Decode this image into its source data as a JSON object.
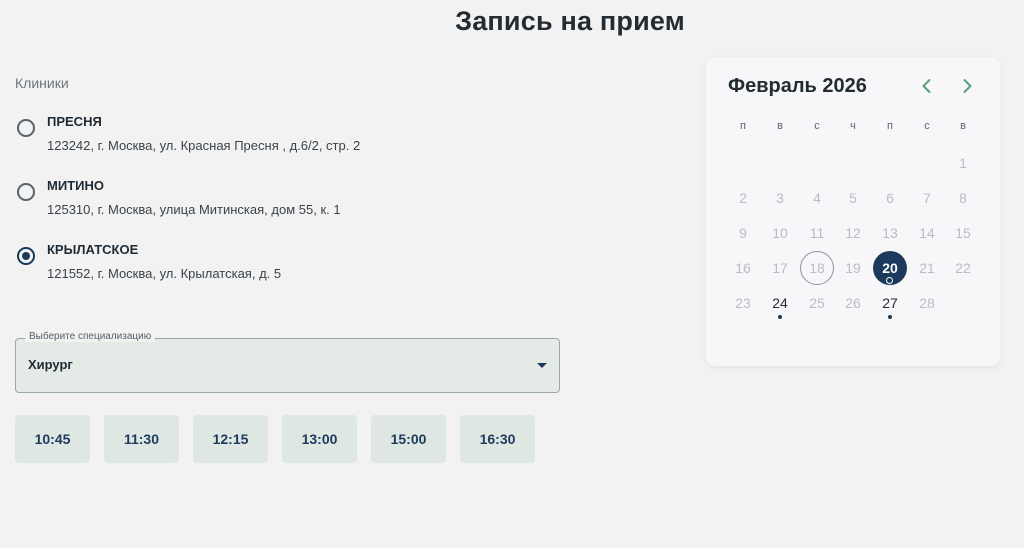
{
  "page": {
    "title": "Запись на прием"
  },
  "clinics": {
    "label": "Клиники",
    "items": [
      {
        "name": "ПРЕСНЯ",
        "address": "123242, г. Москва, ул. Красная Пресня , д.6/2, стр. 2",
        "selected": false
      },
      {
        "name": "МИТИНО",
        "address": "125310, г. Москва, улица Митинская, дом 55, к. 1",
        "selected": false
      },
      {
        "name": "КРЫЛАТСКОЕ",
        "address": "121552, г. Москва, ул. Крылатская, д. 5",
        "selected": true
      }
    ]
  },
  "specialization": {
    "legend": "Выберите специализацию",
    "value": "Хирург"
  },
  "time_slots": [
    "10:45",
    "11:30",
    "12:15",
    "13:00",
    "15:00",
    "16:30"
  ],
  "calendar": {
    "month_title": "Февраль 2026",
    "weekdays": [
      "п",
      "в",
      "с",
      "ч",
      "п",
      "с",
      "в"
    ],
    "first_weekday_index": 6,
    "days_in_month": 28,
    "today": 18,
    "selected": 20,
    "available": [
      20,
      24,
      27
    ],
    "nav_icons": {
      "prev": "chevron-left-icon",
      "next": "chevron-right-icon"
    },
    "colors": {
      "accent": "#1c3a5c",
      "nav": "#5aa07c",
      "muted": "#b7bdc3"
    }
  }
}
